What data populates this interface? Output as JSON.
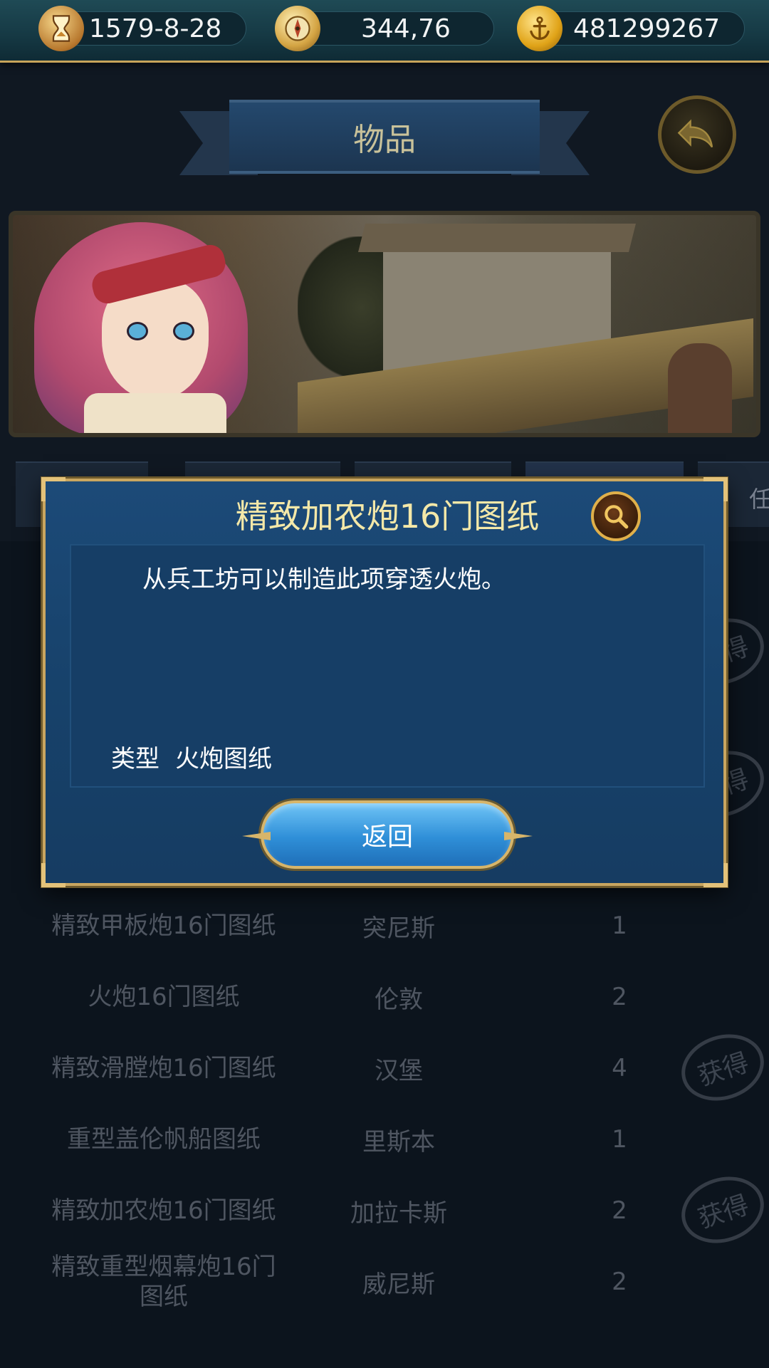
{
  "resources": {
    "date": "1579-8-28",
    "fame": "344,76",
    "gold": "481299267"
  },
  "header": {
    "title": "物品"
  },
  "tabs": {
    "edge_label": "任"
  },
  "modal": {
    "title": "精致加农炮16门图纸",
    "description": "从兵工坊可以制造此项穿透火炮。",
    "type_label": "类型",
    "type_value": "火炮图纸",
    "return_label": "返回"
  },
  "list": {
    "rows": [
      {
        "name": "精致甲板炮16门图纸",
        "city": "突尼斯",
        "qty": "1",
        "obtained": false
      },
      {
        "name": "火炮16门图纸",
        "city": "伦敦",
        "qty": "2",
        "obtained": false
      },
      {
        "name": "精致滑膛炮16门图纸",
        "city": "汉堡",
        "qty": "4",
        "obtained": true
      },
      {
        "name": "重型盖伦帆船图纸",
        "city": "里斯本",
        "qty": "1",
        "obtained": false
      },
      {
        "name": "精致加农炮16门图纸",
        "city": "加拉卡斯",
        "qty": "2",
        "obtained": true
      },
      {
        "name": "精致重型烟幕炮16门图纸",
        "city": "威尼斯",
        "qty": "2",
        "obtained": false
      }
    ],
    "stamp_label": "获得"
  }
}
